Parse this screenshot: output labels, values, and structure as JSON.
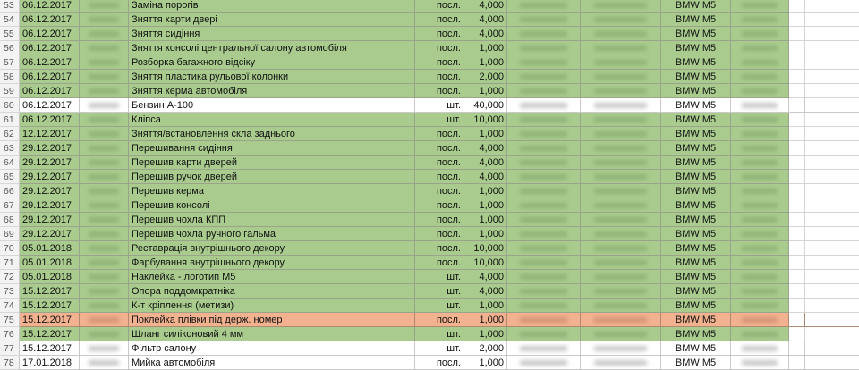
{
  "spreadsheet": {
    "colors": {
      "green": "#a9cc8e",
      "orange": "#f2b28f",
      "white": "#ffffff",
      "rownum_bg": "#f3f3f3"
    },
    "rows": [
      {
        "num": "53",
        "date": "06.12.2017",
        "code": "",
        "name": "Заміна порогів",
        "unit": "посл.",
        "qty": "4,000",
        "p1": "",
        "p2": "",
        "car": "BMW M5",
        "doc": "",
        "fill": "green"
      },
      {
        "num": "54",
        "date": "06.12.2017",
        "code": "",
        "name": "Зняття карти двері",
        "unit": "посл.",
        "qty": "4,000",
        "p1": "",
        "p2": "",
        "car": "BMW M5",
        "doc": "",
        "fill": "green"
      },
      {
        "num": "55",
        "date": "06.12.2017",
        "code": "",
        "name": "Зняття сидіння",
        "unit": "посл.",
        "qty": "4,000",
        "p1": "",
        "p2": "",
        "car": "BMW M5",
        "doc": "",
        "fill": "green"
      },
      {
        "num": "56",
        "date": "06.12.2017",
        "code": "",
        "name": "Зняття консолі центральної салону автомобіля",
        "unit": "посл.",
        "qty": "1,000",
        "p1": "",
        "p2": "",
        "car": "BMW M5",
        "doc": "",
        "fill": "green"
      },
      {
        "num": "57",
        "date": "06.12.2017",
        "code": "",
        "name": "Розборка багажного відсіку",
        "unit": "посл.",
        "qty": "1,000",
        "p1": "",
        "p2": "",
        "car": "BMW M5",
        "doc": "",
        "fill": "green"
      },
      {
        "num": "58",
        "date": "06.12.2017",
        "code": "",
        "name": "Зняття пластика рульової колонки",
        "unit": "посл.",
        "qty": "2,000",
        "p1": "",
        "p2": "",
        "car": "BMW M5",
        "doc": "",
        "fill": "green"
      },
      {
        "num": "59",
        "date": "06.12.2017",
        "code": "",
        "name": "Зняття керма автомобіля",
        "unit": "посл.",
        "qty": "1,000",
        "p1": "",
        "p2": "",
        "car": "BMW M5",
        "doc": "",
        "fill": "green"
      },
      {
        "num": "60",
        "date": "06.12.2017",
        "code": "",
        "name": "Бензин А-100",
        "unit": "шт.",
        "qty": "40,000",
        "p1": "",
        "p2": "",
        "car": "BMW M5",
        "doc": "",
        "fill": "white"
      },
      {
        "num": "61",
        "date": "06.12.2017",
        "code": "",
        "name": "Кліпса",
        "unit": "шт.",
        "qty": "10,000",
        "p1": "",
        "p2": "",
        "car": "BMW M5",
        "doc": "",
        "fill": "green"
      },
      {
        "num": "62",
        "date": "12.12.2017",
        "code": "",
        "name": "Зняття/встановлення скла заднього",
        "unit": "посл.",
        "qty": "1,000",
        "p1": "",
        "p2": "",
        "car": "BMW M5",
        "doc": "",
        "fill": "green"
      },
      {
        "num": "63",
        "date": "29.12.2017",
        "code": "",
        "name": "Перешивання сидіння",
        "unit": "посл.",
        "qty": "4,000",
        "p1": "",
        "p2": "",
        "car": "BMW M5",
        "doc": "",
        "fill": "green"
      },
      {
        "num": "64",
        "date": "29.12.2017",
        "code": "",
        "name": "Перешив карти дверей",
        "unit": "посл.",
        "qty": "4,000",
        "p1": "",
        "p2": "",
        "car": "BMW M5",
        "doc": "",
        "fill": "green"
      },
      {
        "num": "65",
        "date": "29.12.2017",
        "code": "",
        "name": "Перешив ручок дверей",
        "unit": "посл.",
        "qty": "4,000",
        "p1": "",
        "p2": "",
        "car": "BMW M5",
        "doc": "",
        "fill": "green"
      },
      {
        "num": "66",
        "date": "29.12.2017",
        "code": "",
        "name": "Перешив керма",
        "unit": "посл.",
        "qty": "1,000",
        "p1": "",
        "p2": "",
        "car": "BMW M5",
        "doc": "",
        "fill": "green"
      },
      {
        "num": "67",
        "date": "29.12.2017",
        "code": "",
        "name": "Перешив консолі",
        "unit": "посл.",
        "qty": "1,000",
        "p1": "",
        "p2": "",
        "car": "BMW M5",
        "doc": "",
        "fill": "green"
      },
      {
        "num": "68",
        "date": "29.12.2017",
        "code": "",
        "name": "Перешив чохла КПП",
        "unit": "посл.",
        "qty": "1,000",
        "p1": "",
        "p2": "",
        "car": "BMW M5",
        "doc": "",
        "fill": "green"
      },
      {
        "num": "69",
        "date": "29.12.2017",
        "code": "",
        "name": "Перешив чохла ручного гальма",
        "unit": "посл.",
        "qty": "1,000",
        "p1": "",
        "p2": "",
        "car": "BMW M5",
        "doc": "",
        "fill": "green"
      },
      {
        "num": "70",
        "date": "05.01.2018",
        "code": "",
        "name": "Реставрація внутрішнього декору",
        "unit": "посл.",
        "qty": "10,000",
        "p1": "",
        "p2": "",
        "car": "BMW M5",
        "doc": "",
        "fill": "green"
      },
      {
        "num": "71",
        "date": "05.01.2018",
        "code": "",
        "name": "Фарбування внутрішнього декору",
        "unit": "посл.",
        "qty": "10,000",
        "p1": "",
        "p2": "",
        "car": "BMW M5",
        "doc": "",
        "fill": "green"
      },
      {
        "num": "72",
        "date": "05.01.2018",
        "code": "",
        "name": "Наклейка - логотип М5",
        "unit": "шт.",
        "qty": "4,000",
        "p1": "",
        "p2": "",
        "car": "BMW M5",
        "doc": "",
        "fill": "green"
      },
      {
        "num": "73",
        "date": "15.12.2017",
        "code": "",
        "name": "Опора поддомкратніка",
        "unit": "шт.",
        "qty": "4,000",
        "p1": "",
        "p2": "",
        "car": "BMW M5",
        "doc": "",
        "fill": "green"
      },
      {
        "num": "74",
        "date": "15.12.2017",
        "code": "",
        "name": "К-т кріплення (метизи)",
        "unit": "шт.",
        "qty": "1,000",
        "p1": "",
        "p2": "",
        "car": "BMW M5",
        "doc": "",
        "fill": "green"
      },
      {
        "num": "75",
        "date": "15.12.2017",
        "code": "",
        "name": "Поклейка плівки під держ. номер",
        "unit": "посл.",
        "qty": "1,000",
        "p1": "",
        "p2": "",
        "car": "BMW M5",
        "doc": "",
        "fill": "orange"
      },
      {
        "num": "76",
        "date": "15.12.2017",
        "code": "",
        "name": "Шланг силіконовий 4 мм",
        "unit": "шт.",
        "qty": "1,000",
        "p1": "",
        "p2": "",
        "car": "BMW M5",
        "doc": "",
        "fill": "green"
      },
      {
        "num": "77",
        "date": "15.12.2017",
        "code": "",
        "name": "Фільтр салону",
        "unit": "шт.",
        "qty": "2,000",
        "p1": "",
        "p2": "",
        "car": "BMW M5",
        "doc": "",
        "fill": "white"
      },
      {
        "num": "78",
        "date": "17.01.2018",
        "code": "",
        "name": "Мийка автомобіля",
        "unit": "посл.",
        "qty": "1,000",
        "p1": "",
        "p2": "",
        "car": "BMW M5",
        "doc": "",
        "fill": "white"
      }
    ]
  }
}
